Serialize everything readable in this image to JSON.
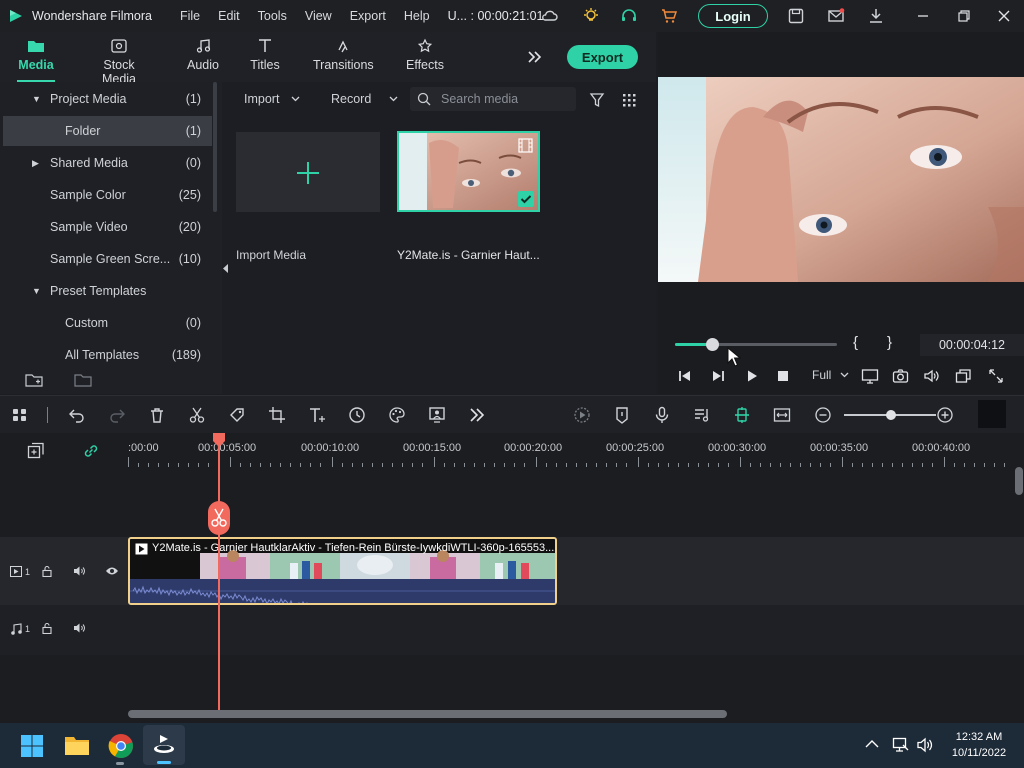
{
  "app": {
    "name": "Wondershare Filmora",
    "menu": [
      "File",
      "Edit",
      "Tools",
      "View",
      "Export",
      "Help"
    ],
    "project_time": "U... : 00:00:21:01",
    "login_label": "Login",
    "accent": "#2fd1a6"
  },
  "tabs": [
    {
      "label": "Media",
      "icon": "media-folder-icon",
      "active": true
    },
    {
      "label": "Stock Media",
      "icon": "stock-media-icon"
    },
    {
      "label": "Audio",
      "icon": "music-note-icon"
    },
    {
      "label": "Titles",
      "icon": "text-t-icon"
    },
    {
      "label": "Transitions",
      "icon": "transitions-icon"
    },
    {
      "label": "Effects",
      "icon": "effects-icon"
    }
  ],
  "export_label": "Export",
  "tree": [
    {
      "label": "Project Media",
      "count": "(1)",
      "expanded": true
    },
    {
      "label": "Folder",
      "count": "(1)",
      "selected": true
    },
    {
      "label": "Shared Media",
      "count": "(0)",
      "collapsed": true
    },
    {
      "label": "Sample Color",
      "count": "(25)"
    },
    {
      "label": "Sample Video",
      "count": "(20)"
    },
    {
      "label": "Sample Green Scre...",
      "count": "(10)"
    },
    {
      "label": "Preset Templates",
      "count": "",
      "expanded": true
    },
    {
      "label": "Custom",
      "count": "(0)"
    },
    {
      "label": "All Templates",
      "count": "(189)"
    }
  ],
  "media_toolbar": {
    "import_label": "Import",
    "record_label": "Record",
    "search_placeholder": "Search media"
  },
  "media_items": {
    "import_label": "Import Media",
    "clip_label": "Y2Mate.is - Garnier Haut..."
  },
  "preview": {
    "timecode": "00:00:04:12",
    "quality": "Full",
    "progress": 0.23
  },
  "timeline": {
    "ruler": [
      ":00:00",
      "00:00:05:00",
      "00:00:10:00",
      "00:00:15:00",
      "00:00:20:00",
      "00:00:25:00",
      "00:00:30:00",
      "00:00:35:00",
      "00:00:40:00"
    ],
    "clip_title": "Y2Mate.is - Garnier HautklarAktiv - Tiefen-Rein Bürste-IywkdiWTLI-360p-165553...",
    "video_track_number": "1",
    "audio_track_number": "1"
  },
  "taskbar": {
    "time": "12:32 AM",
    "date": "10/11/2022"
  }
}
